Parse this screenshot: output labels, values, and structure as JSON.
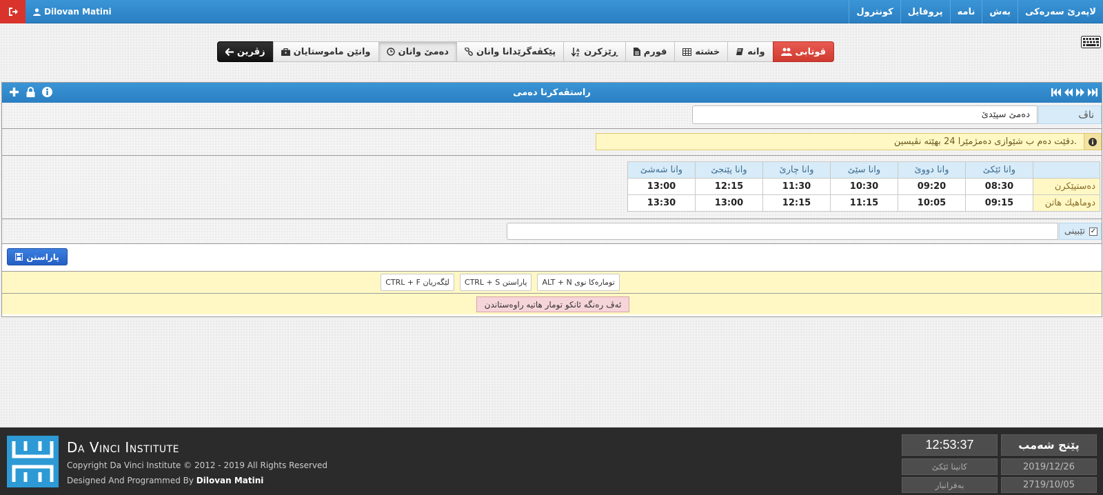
{
  "topbar": {
    "user_name": "Dilovan Matini",
    "nav": [
      "لاپەرێ سەرەکی",
      "بەش",
      "نامە",
      "پروفایل",
      "کونترول"
    ]
  },
  "tabs": [
    {
      "label": "قوتابی",
      "icon": "users-icon",
      "style": "red"
    },
    {
      "label": "وانە",
      "icon": "book-icon"
    },
    {
      "label": "خشتە",
      "icon": "table-icon"
    },
    {
      "label": "فورم",
      "icon": "file-icon"
    },
    {
      "label": "ڕێزکرن",
      "icon": "sort-icon"
    },
    {
      "label": "پێکڤەگرێدانا وانان",
      "icon": "link-icon"
    },
    {
      "label": "دەمێ وانان",
      "icon": "clock-icon",
      "style": "active"
    },
    {
      "label": "وانێن ماموستایان",
      "icon": "briefcase-icon"
    },
    {
      "label": "زڤرین",
      "icon": "arrow-left-icon",
      "style": "dark"
    }
  ],
  "panel": {
    "title": "راستڤەکرنا دەمی",
    "name_label": "ناڤ",
    "name_value": "دەمێ سپێدێ",
    "info_text": "دقێت دەم ب شێوازی دەمژمێرا 24 بهێتە نڤیسین.",
    "schedule": {
      "headers": [
        "وانا ئێکێ",
        "وانا دووێ",
        "وانا سێێ",
        "وانا چارێ",
        "وانا پێنجێ",
        "وانا شەشێ"
      ],
      "rows": [
        {
          "label": "دەستپێکرن",
          "values": [
            "08:30",
            "09:20",
            "10:30",
            "11:30",
            "12:15",
            "13:00"
          ]
        },
        {
          "label": "دوماهیك هاتن",
          "values": [
            "09:15",
            "10:05",
            "11:15",
            "12:15",
            "13:00",
            "13:30"
          ]
        }
      ]
    },
    "note_label": "تێبینی",
    "save_label": "پاراستن",
    "shortcuts": [
      {
        "keys": "ALT + N",
        "action": "تومارەکا نوی"
      },
      {
        "keys": "CTRL + S",
        "action": "پاراستن"
      },
      {
        "keys": "CTRL + F",
        "action": "لێگەریان"
      }
    ],
    "legend": "ئەڤ رەنگە ئانکو تومار هاتیە راوەستاندن"
  },
  "footer": {
    "institute": "Da Vinci Institute",
    "copyright": "Copyright Da Vinci Institute © 2012 - 2019 All Rights Reserved",
    "designed_prefix": "Designed And Programmed By",
    "designer": "Dilovan Matini",
    "clock": "12:53:37",
    "day": "پێنج شەمب",
    "season": "کانینا ئێکێ",
    "gregorian_date": "2019/12/26",
    "kurdish_month": "بەفرانبار",
    "kurdish_date": "2719/10/05"
  },
  "colors": {
    "header_blue": "#2a7fc2",
    "danger_red": "#d9342b",
    "highlight_yellow": "#fff8c4",
    "stopped_pink": "#f6d5d9",
    "footer_dark": "#2b2b2b"
  }
}
